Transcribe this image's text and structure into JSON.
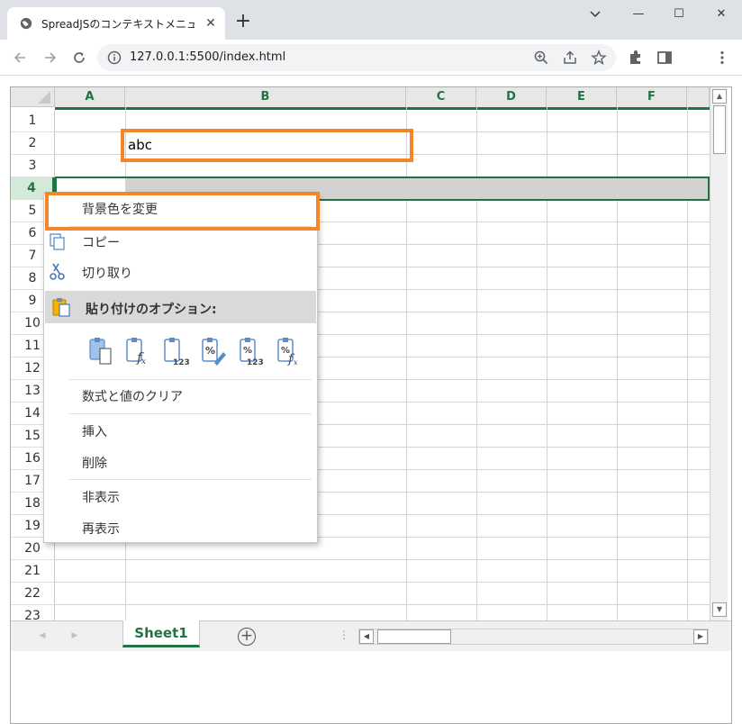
{
  "browser": {
    "tab_title": "SpreadJSのコンテキストメニューのカスタ",
    "tab_close": "✕",
    "new_tab": "+",
    "url": "127.0.0.1:5500/index.html",
    "minimize": "—",
    "maximize": "☐",
    "close": "✕"
  },
  "sheet": {
    "columns": [
      "A",
      "B",
      "C",
      "D",
      "E",
      "F"
    ],
    "rows": [
      "1",
      "2",
      "3",
      "4",
      "5",
      "6",
      "7",
      "8",
      "9",
      "10",
      "11",
      "12",
      "13",
      "14",
      "15",
      "16",
      "17",
      "18",
      "19",
      "20",
      "21",
      "22",
      "23"
    ],
    "selected_row": "4",
    "cell_b2": "abc",
    "tab_name": "Sheet1",
    "add_sheet": "+"
  },
  "context_menu": {
    "change_bg": "背景色を変更",
    "copy": "コピー",
    "cut": "切り取り",
    "paste_options": "貼り付けのオプション:",
    "paste_opts": [
      "paste-all",
      "paste-formulas",
      "paste-values",
      "paste-formatting",
      "paste-values-formatting",
      "paste-formulas-formatting"
    ],
    "clear_contents": "数式と値のクリア",
    "insert": "挿入",
    "delete": "削除",
    "hide": "非表示",
    "unhide": "再表示"
  },
  "colors": {
    "accent_green": "#217346",
    "highlight_orange": "#f4862a",
    "selection_fill": "#d2d2d2"
  }
}
